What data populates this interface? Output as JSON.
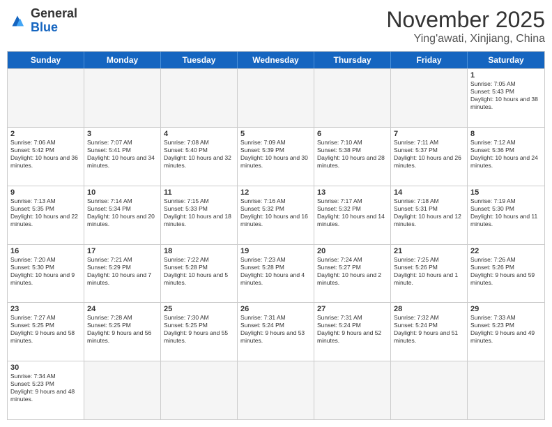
{
  "header": {
    "logo_general": "General",
    "logo_blue": "Blue",
    "month_title": "November 2025",
    "location": "Ying'awati, Xinjiang, China"
  },
  "days": [
    "Sunday",
    "Monday",
    "Tuesday",
    "Wednesday",
    "Thursday",
    "Friday",
    "Saturday"
  ],
  "weeks": [
    [
      {
        "date": "",
        "empty": true
      },
      {
        "date": "",
        "empty": true
      },
      {
        "date": "",
        "empty": true
      },
      {
        "date": "",
        "empty": true
      },
      {
        "date": "",
        "empty": true
      },
      {
        "date": "",
        "empty": true
      },
      {
        "date": "1",
        "sunrise": "Sunrise: 7:05 AM",
        "sunset": "Sunset: 5:43 PM",
        "daylight": "Daylight: 10 hours and 38 minutes."
      }
    ],
    [
      {
        "date": "2",
        "sunrise": "Sunrise: 7:06 AM",
        "sunset": "Sunset: 5:42 PM",
        "daylight": "Daylight: 10 hours and 36 minutes."
      },
      {
        "date": "3",
        "sunrise": "Sunrise: 7:07 AM",
        "sunset": "Sunset: 5:41 PM",
        "daylight": "Daylight: 10 hours and 34 minutes."
      },
      {
        "date": "4",
        "sunrise": "Sunrise: 7:08 AM",
        "sunset": "Sunset: 5:40 PM",
        "daylight": "Daylight: 10 hours and 32 minutes."
      },
      {
        "date": "5",
        "sunrise": "Sunrise: 7:09 AM",
        "sunset": "Sunset: 5:39 PM",
        "daylight": "Daylight: 10 hours and 30 minutes."
      },
      {
        "date": "6",
        "sunrise": "Sunrise: 7:10 AM",
        "sunset": "Sunset: 5:38 PM",
        "daylight": "Daylight: 10 hours and 28 minutes."
      },
      {
        "date": "7",
        "sunrise": "Sunrise: 7:11 AM",
        "sunset": "Sunset: 5:37 PM",
        "daylight": "Daylight: 10 hours and 26 minutes."
      },
      {
        "date": "8",
        "sunrise": "Sunrise: 7:12 AM",
        "sunset": "Sunset: 5:36 PM",
        "daylight": "Daylight: 10 hours and 24 minutes."
      }
    ],
    [
      {
        "date": "9",
        "sunrise": "Sunrise: 7:13 AM",
        "sunset": "Sunset: 5:35 PM",
        "daylight": "Daylight: 10 hours and 22 minutes."
      },
      {
        "date": "10",
        "sunrise": "Sunrise: 7:14 AM",
        "sunset": "Sunset: 5:34 PM",
        "daylight": "Daylight: 10 hours and 20 minutes."
      },
      {
        "date": "11",
        "sunrise": "Sunrise: 7:15 AM",
        "sunset": "Sunset: 5:33 PM",
        "daylight": "Daylight: 10 hours and 18 minutes."
      },
      {
        "date": "12",
        "sunrise": "Sunrise: 7:16 AM",
        "sunset": "Sunset: 5:32 PM",
        "daylight": "Daylight: 10 hours and 16 minutes."
      },
      {
        "date": "13",
        "sunrise": "Sunrise: 7:17 AM",
        "sunset": "Sunset: 5:32 PM",
        "daylight": "Daylight: 10 hours and 14 minutes."
      },
      {
        "date": "14",
        "sunrise": "Sunrise: 7:18 AM",
        "sunset": "Sunset: 5:31 PM",
        "daylight": "Daylight: 10 hours and 12 minutes."
      },
      {
        "date": "15",
        "sunrise": "Sunrise: 7:19 AM",
        "sunset": "Sunset: 5:30 PM",
        "daylight": "Daylight: 10 hours and 11 minutes."
      }
    ],
    [
      {
        "date": "16",
        "sunrise": "Sunrise: 7:20 AM",
        "sunset": "Sunset: 5:30 PM",
        "daylight": "Daylight: 10 hours and 9 minutes."
      },
      {
        "date": "17",
        "sunrise": "Sunrise: 7:21 AM",
        "sunset": "Sunset: 5:29 PM",
        "daylight": "Daylight: 10 hours and 7 minutes."
      },
      {
        "date": "18",
        "sunrise": "Sunrise: 7:22 AM",
        "sunset": "Sunset: 5:28 PM",
        "daylight": "Daylight: 10 hours and 5 minutes."
      },
      {
        "date": "19",
        "sunrise": "Sunrise: 7:23 AM",
        "sunset": "Sunset: 5:28 PM",
        "daylight": "Daylight: 10 hours and 4 minutes."
      },
      {
        "date": "20",
        "sunrise": "Sunrise: 7:24 AM",
        "sunset": "Sunset: 5:27 PM",
        "daylight": "Daylight: 10 hours and 2 minutes."
      },
      {
        "date": "21",
        "sunrise": "Sunrise: 7:25 AM",
        "sunset": "Sunset: 5:26 PM",
        "daylight": "Daylight: 10 hours and 1 minute."
      },
      {
        "date": "22",
        "sunrise": "Sunrise: 7:26 AM",
        "sunset": "Sunset: 5:26 PM",
        "daylight": "Daylight: 9 hours and 59 minutes."
      }
    ],
    [
      {
        "date": "23",
        "sunrise": "Sunrise: 7:27 AM",
        "sunset": "Sunset: 5:25 PM",
        "daylight": "Daylight: 9 hours and 58 minutes."
      },
      {
        "date": "24",
        "sunrise": "Sunrise: 7:28 AM",
        "sunset": "Sunset: 5:25 PM",
        "daylight": "Daylight: 9 hours and 56 minutes."
      },
      {
        "date": "25",
        "sunrise": "Sunrise: 7:30 AM",
        "sunset": "Sunset: 5:25 PM",
        "daylight": "Daylight: 9 hours and 55 minutes."
      },
      {
        "date": "26",
        "sunrise": "Sunrise: 7:31 AM",
        "sunset": "Sunset: 5:24 PM",
        "daylight": "Daylight: 9 hours and 53 minutes."
      },
      {
        "date": "27",
        "sunrise": "Sunrise: 7:31 AM",
        "sunset": "Sunset: 5:24 PM",
        "daylight": "Daylight: 9 hours and 52 minutes."
      },
      {
        "date": "28",
        "sunrise": "Sunrise: 7:32 AM",
        "sunset": "Sunset: 5:24 PM",
        "daylight": "Daylight: 9 hours and 51 minutes."
      },
      {
        "date": "29",
        "sunrise": "Sunrise: 7:33 AM",
        "sunset": "Sunset: 5:23 PM",
        "daylight": "Daylight: 9 hours and 49 minutes."
      }
    ],
    [
      {
        "date": "30",
        "sunrise": "Sunrise: 7:34 AM",
        "sunset": "Sunset: 5:23 PM",
        "daylight": "Daylight: 9 hours and 48 minutes."
      },
      {
        "date": "",
        "empty": true
      },
      {
        "date": "",
        "empty": true
      },
      {
        "date": "",
        "empty": true
      },
      {
        "date": "",
        "empty": true
      },
      {
        "date": "",
        "empty": true
      },
      {
        "date": "",
        "empty": true
      }
    ]
  ]
}
